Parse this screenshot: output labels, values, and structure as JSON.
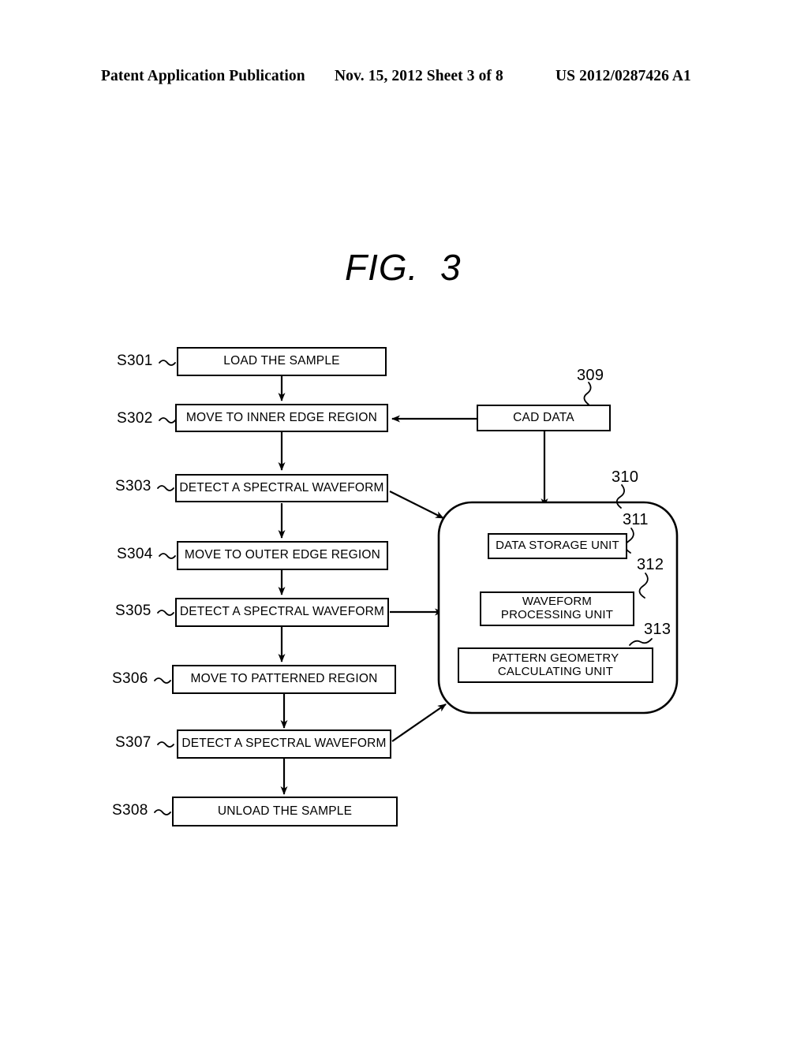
{
  "header": {
    "left": "Patent Application Publication",
    "middle": "Nov. 15, 2012  Sheet 3 of 8",
    "right": "US 2012/0287426 A1"
  },
  "figure": {
    "title": "FIG.  3"
  },
  "flow": {
    "steps": [
      {
        "id": "S301",
        "label": "LOAD THE SAMPLE"
      },
      {
        "id": "S302",
        "label": "MOVE TO INNER EDGE REGION"
      },
      {
        "id": "S303",
        "label": "DETECT A SPECTRAL WAVEFORM"
      },
      {
        "id": "S304",
        "label": "MOVE TO OUTER EDGE REGION"
      },
      {
        "id": "S305",
        "label": "DETECT A SPECTRAL WAVEFORM"
      },
      {
        "id": "S306",
        "label": "MOVE TO PATTERNED REGION"
      },
      {
        "id": "S307",
        "label": "DETECT A SPECTRAL WAVEFORM"
      },
      {
        "id": "S308",
        "label": "UNLOAD THE SAMPLE"
      }
    ]
  },
  "cad": {
    "label": "CAD DATA",
    "ref": "309"
  },
  "processor": {
    "ref": "310",
    "units": [
      {
        "ref": "311",
        "label": "DATA STORAGE UNIT"
      },
      {
        "ref": "312",
        "label": "WAVEFORM\nPROCESSING UNIT"
      },
      {
        "ref": "313",
        "label": "PATTERN GEOMETRY\nCALCULATING UNIT"
      }
    ]
  }
}
